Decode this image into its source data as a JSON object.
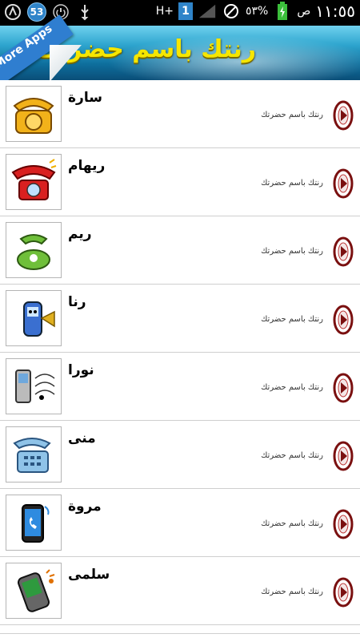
{
  "status_bar": {
    "badge_count": "53",
    "network": "H+",
    "sim_slot": "1",
    "battery": "٥٣%",
    "time": "١١:٥٥",
    "time_suffix": "ص"
  },
  "header": {
    "title": "رنتك باسم حضرتك",
    "more_apps": "More Apps"
  },
  "list": {
    "items": [
      {
        "name": "سارة",
        "subtitle": "رنتك باسم حضرتك",
        "icon": "rotary-phone-icon"
      },
      {
        "name": "ريهام",
        "subtitle": "رنتك باسم حضرتك",
        "icon": "red-phone-icon"
      },
      {
        "name": "ريم",
        "subtitle": "رنتك باسم حضرتك",
        "icon": "green-phone-icon"
      },
      {
        "name": "رنا",
        "subtitle": "رنتك باسم حضرتك",
        "icon": "mobile-trumpet-icon"
      },
      {
        "name": "نورا",
        "subtitle": "رنتك باسم حضرتك",
        "icon": "phone-music-icon"
      },
      {
        "name": "منى",
        "subtitle": "رنتك باسم حضرتك",
        "icon": "desk-phone-icon"
      },
      {
        "name": "مروة",
        "subtitle": "رنتك باسم حضرتك",
        "icon": "smartphone-call-icon"
      },
      {
        "name": "سلمى",
        "subtitle": "رنتك باسم حضرتك",
        "icon": "ringing-mobile-icon"
      }
    ]
  },
  "colors": {
    "title": "#f6e600",
    "header_dark": "#0a4e78",
    "play_ring": "#7a1010"
  }
}
